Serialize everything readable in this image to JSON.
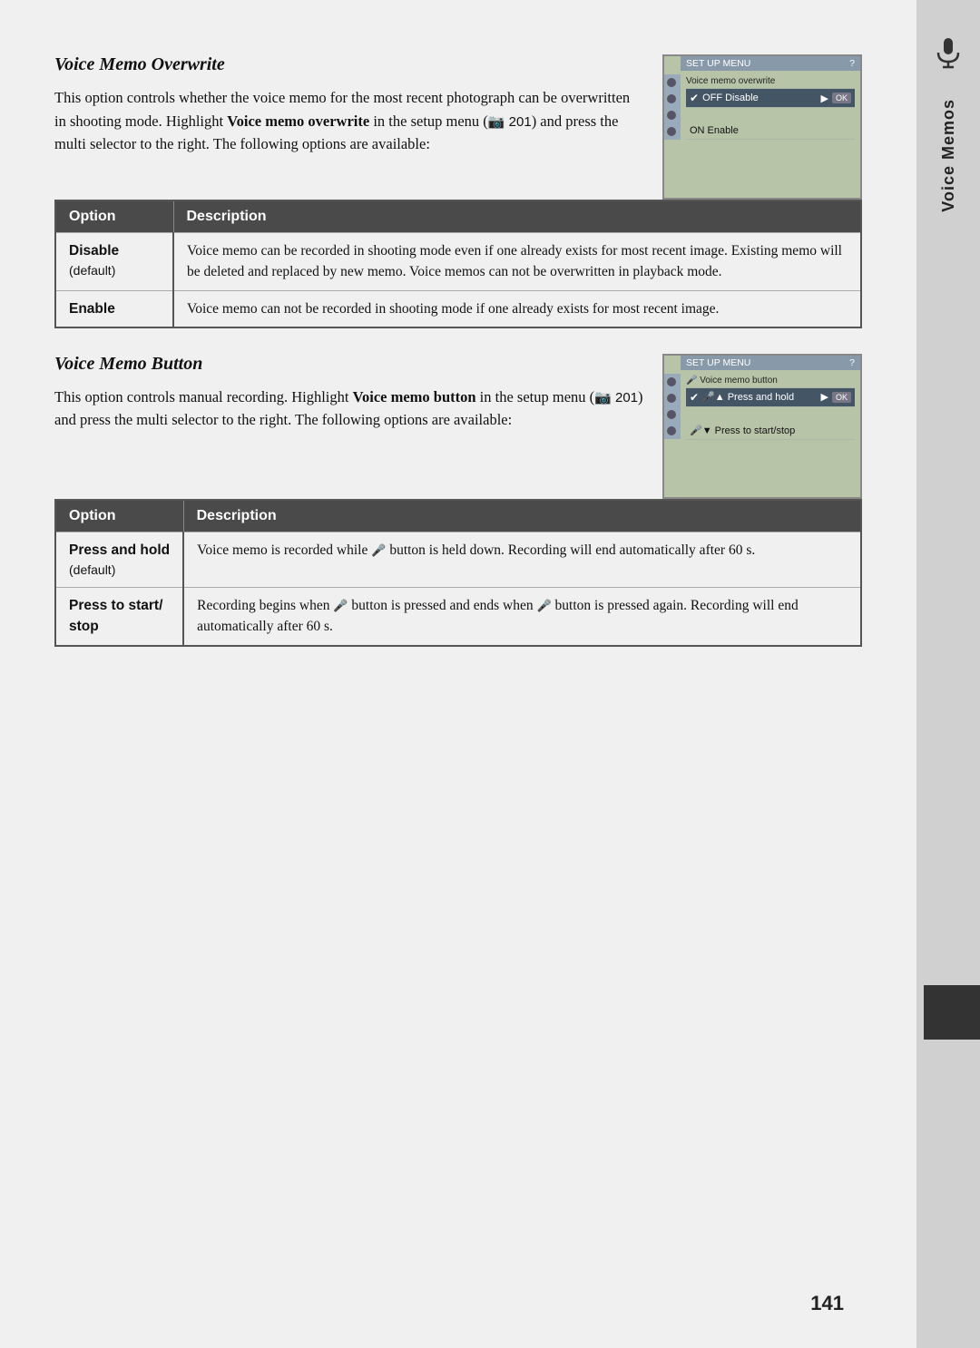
{
  "page": {
    "number": "141",
    "tab_label": "Voice Memos"
  },
  "section1": {
    "title": "Voice Memo Overwrite",
    "body": "This option controls whether the voice memo for the most recent photograph can be overwritten in shooting mode.  Highlight ",
    "bold1": "Voice memo over-write",
    "body2": " in the setup menu (",
    "ref": "🔧 201",
    "body3": ") and press the multi selector to the right.  The following options are available:",
    "table": {
      "col1": "Option",
      "col2": "Description",
      "rows": [
        {
          "option": "Disable",
          "sub": "(default)",
          "description": "Voice memo can be recorded in shooting mode even if one already exists for most recent image.  Existing memo will be deleted and replaced by new memo.  Voice memos can not be overwritten in playback mode."
        },
        {
          "option": "Enable",
          "sub": "",
          "description": "Voice memo can not be recorded in shooting mode if one already exists for most recent image."
        }
      ]
    },
    "screen": {
      "title": "SET UP MENU",
      "subtitle": "Voice memo overwrite",
      "rows": [
        {
          "label": "✔ OFF  Disable",
          "selected": true,
          "ok": true
        },
        {
          "label": "ON  Enable",
          "selected": false,
          "ok": false
        }
      ]
    }
  },
  "section2": {
    "title": "Voice Memo Button",
    "body": "This option controls manual recording.  Highlight ",
    "bold1": "Voice memo button",
    "body2": " in the setup menu (",
    "ref": "🔧 201",
    "body3": ") and press the multi selector to the right.  The following options are available:",
    "table": {
      "col1": "Option",
      "col2": "Description",
      "rows": [
        {
          "option": "Press and hold",
          "sub": "(default)",
          "description": "Voice memo is recorded while 🎤 button is held down.  Recording will end automatically after 60 s."
        },
        {
          "option": "Press to start/\nstop",
          "sub": "",
          "description": "Recording begins when 🎤 button is pressed and ends when 🎤 button is pressed again.  Recording will end automatically after 60 s."
        }
      ]
    },
    "screen": {
      "title": "SET UP MENU",
      "subtitle": "Voice memo button",
      "rows": [
        {
          "label": "🎤▲  Press and hold",
          "selected": true,
          "ok": true
        },
        {
          "label": "🎤▼  Press to start/stop",
          "selected": false,
          "ok": false
        }
      ]
    }
  }
}
